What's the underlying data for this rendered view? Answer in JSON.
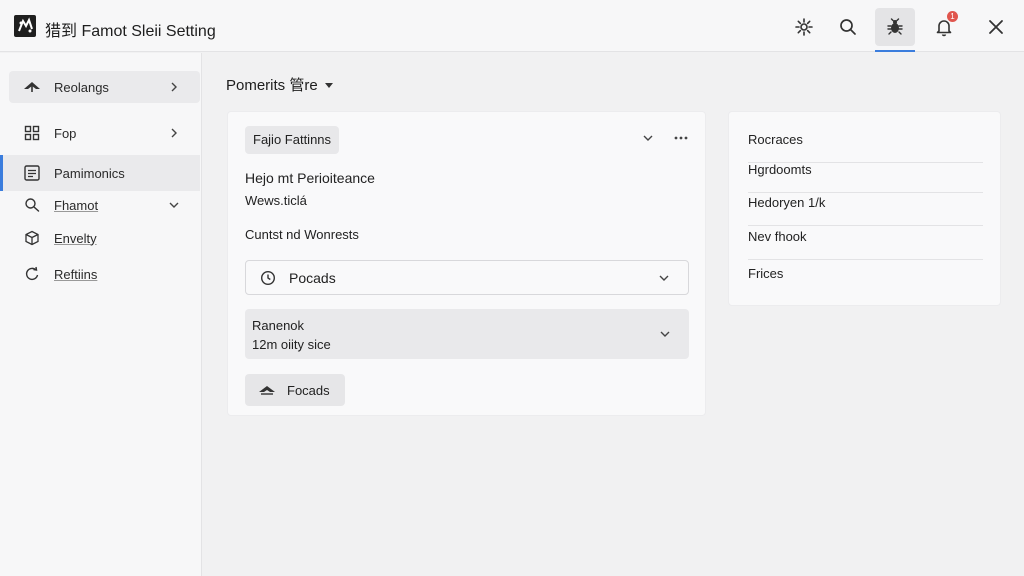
{
  "window": {
    "title": "猎到 Famot Sleii Setting",
    "actions": [
      {
        "name": "settings-gear",
        "icon": "gear-icon"
      },
      {
        "name": "search",
        "icon": "search-icon"
      },
      {
        "name": "bug",
        "icon": "bug-icon",
        "active": true
      },
      {
        "name": "notifications",
        "icon": "bell-icon",
        "badge": "1"
      },
      {
        "name": "close",
        "icon": "close-icon"
      }
    ]
  },
  "sidebar": {
    "items": [
      {
        "label": "Reolangs",
        "icon": "airplane-icon",
        "chevron": "right"
      },
      {
        "label": "Fop",
        "icon": "grid-icon",
        "chevron": "right"
      },
      {
        "label": "Pamimonics",
        "icon": "document-list-icon",
        "selected": true
      },
      {
        "label": "Fhamot",
        "icon": "search-icon",
        "chevron": "down"
      },
      {
        "label": "Envelty",
        "icon": "cube-icon"
      },
      {
        "label": "Reftiins",
        "icon": "refresh-icon"
      }
    ]
  },
  "breadcrumb": {
    "label": "Pomerits 管re"
  },
  "main_card": {
    "chip": "Fajio Fattinns",
    "heading": "Hejo mt Perioiteance",
    "sub": "Wews.ticlá",
    "section_label": "Cuntst nd Wonrests",
    "dropdown1": {
      "value": "Pocads",
      "icon": "clock-icon"
    },
    "dropdown2": {
      "line1": "Ranenok",
      "line2": "12m oiity sice"
    },
    "action_button": {
      "label": "Focads",
      "icon": "airplane-icon"
    }
  },
  "side_card": {
    "items": [
      "Rocraces",
      "Hgrdoomts",
      "Hedoryen 1/k",
      "Nev fhook",
      "Frices"
    ]
  },
  "colors": {
    "accent": "#3b7ddd",
    "badge": "#e0554d",
    "background": "#f1f1f2"
  }
}
